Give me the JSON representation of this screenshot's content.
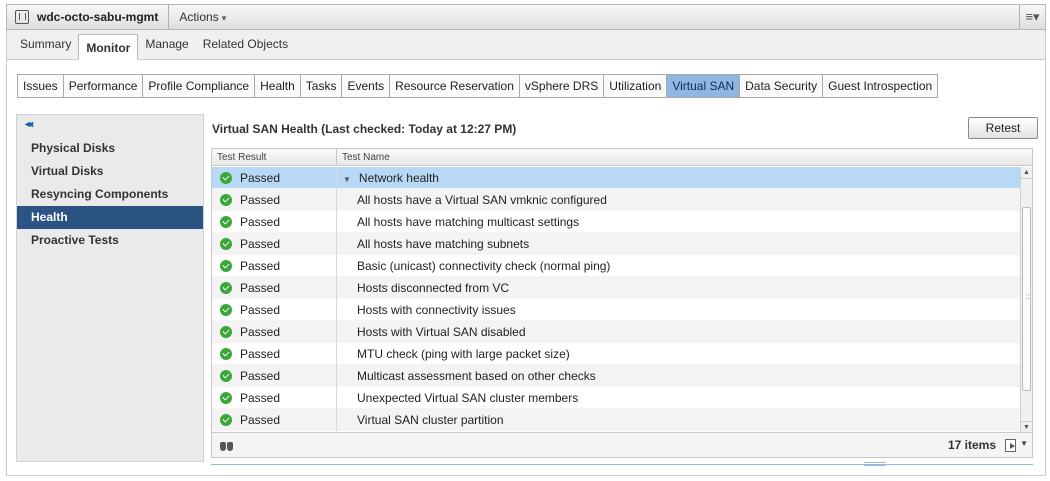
{
  "header": {
    "title": "wdc-octo-sabu-mgmt",
    "actions_label": "Actions",
    "actions_caret": "▾",
    "menu_glyph": "≡▾"
  },
  "main_tabs": [
    {
      "label": "Summary"
    },
    {
      "label": "Monitor",
      "active": true
    },
    {
      "label": "Manage"
    },
    {
      "label": "Related Objects"
    }
  ],
  "sub_tabs": [
    {
      "label": "Issues"
    },
    {
      "label": "Performance"
    },
    {
      "label": "Profile Compliance"
    },
    {
      "label": "Health"
    },
    {
      "label": "Tasks"
    },
    {
      "label": "Events"
    },
    {
      "label": "Resource Reservation"
    },
    {
      "label": "vSphere DRS"
    },
    {
      "label": "Utilization"
    },
    {
      "label": "Virtual SAN",
      "active": true
    },
    {
      "label": "Data Security"
    },
    {
      "label": "Guest Introspection"
    }
  ],
  "left_nav": {
    "collapse_glyph": "◂◂",
    "items": [
      {
        "label": "Physical Disks"
      },
      {
        "label": "Virtual Disks"
      },
      {
        "label": "Resyncing Components"
      },
      {
        "label": "Health",
        "active": true
      },
      {
        "label": "Proactive Tests"
      }
    ]
  },
  "panel": {
    "title": "Virtual SAN Health (Last checked: Today at 12:27 PM)",
    "retest_label": "Retest"
  },
  "grid": {
    "columns": [
      "Test Result",
      "Test Name"
    ],
    "rows": [
      {
        "result": "Passed",
        "name": "Network health",
        "group": true,
        "selected": true
      },
      {
        "result": "Passed",
        "name": "All hosts have a Virtual SAN vmknic configured"
      },
      {
        "result": "Passed",
        "name": "All hosts have matching multicast settings"
      },
      {
        "result": "Passed",
        "name": "All hosts have matching subnets"
      },
      {
        "result": "Passed",
        "name": "Basic (unicast) connectivity check (normal ping)"
      },
      {
        "result": "Passed",
        "name": "Hosts disconnected from VC"
      },
      {
        "result": "Passed",
        "name": "Hosts with connectivity issues"
      },
      {
        "result": "Passed",
        "name": "Hosts with Virtual SAN disabled"
      },
      {
        "result": "Passed",
        "name": "MTU check (ping with large packet size)"
      },
      {
        "result": "Passed",
        "name": "Multicast assessment based on other checks"
      },
      {
        "result": "Passed",
        "name": "Unexpected Virtual SAN cluster members"
      },
      {
        "result": "Passed",
        "name": "Virtual SAN cluster partition"
      }
    ],
    "item_count": "17 items",
    "expander_glyph": "▼",
    "scroll_up": "▲",
    "scroll_down": "▼",
    "grip_glyph": "::",
    "export_caret": "▼"
  },
  "colors": {
    "status_passed": "#39a839",
    "nav_active": "#2b5383",
    "selected_row": "#b8d9f5",
    "subtab_active": "#8fb7e0"
  }
}
